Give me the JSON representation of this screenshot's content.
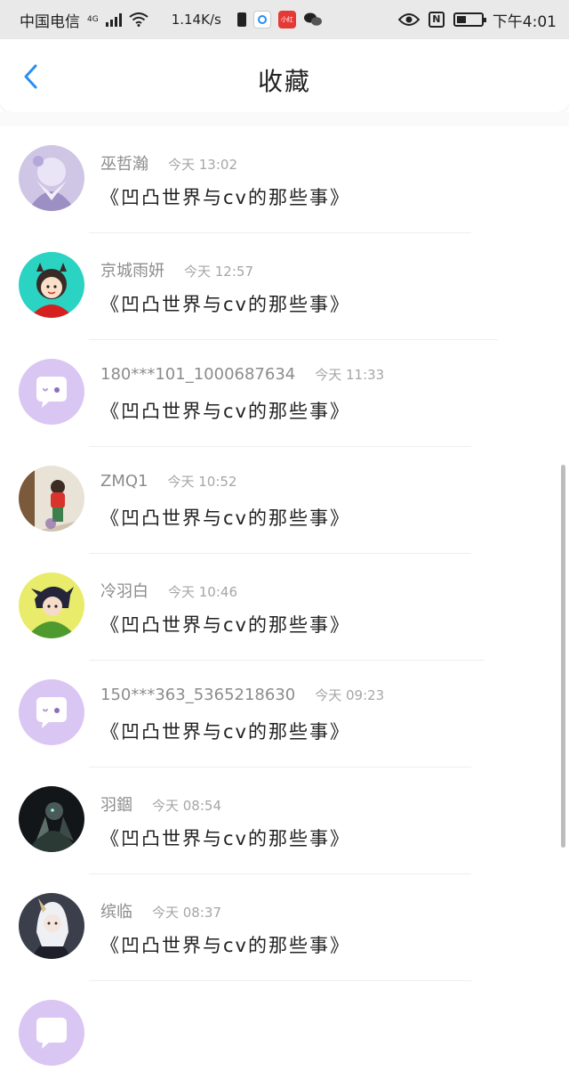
{
  "status_bar": {
    "carrier": "中国电信",
    "network": "4G",
    "speed": "1.14K/s",
    "app_badge": "小红书",
    "time": "下午4:01",
    "icons": [
      "signal-icon",
      "wifi-icon",
      "sim-alert-icon",
      "browser-icon",
      "xiaohongshu-icon",
      "wechat-icon",
      "eye-icon",
      "nfc-icon",
      "battery-icon"
    ]
  },
  "header": {
    "title": "收藏",
    "back_icon": "chevron-left-icon",
    "accent": "#2a8ef0"
  },
  "items": [
    {
      "user": "巫哲瀚",
      "time": "今天 13:02",
      "title": "《凹凸世界与cv的那些事》",
      "avatar": "anime-lavender"
    },
    {
      "user": "京城雨妍",
      "time": "今天 12:57",
      "title": "《凹凸世界与cv的那些事》",
      "avatar": "cartoon-girl-teal"
    },
    {
      "user": "180***101_1000687634",
      "time": "今天 11:33",
      "title": "《凹凸世界与cv的那些事》",
      "avatar": "default-chat"
    },
    {
      "user": "ZMQ1",
      "time": "今天 10:52",
      "title": "《凹凸世界与cv的那些事》",
      "avatar": "photo-child"
    },
    {
      "user": "冷羽白",
      "time": "今天 10:46",
      "title": "《凹凸世界与cv的那些事》",
      "avatar": "anime-boy-green"
    },
    {
      "user": "150***363_5365218630",
      "time": "今天 09:23",
      "title": "《凹凸世界与cv的那些事》",
      "avatar": "default-chat"
    },
    {
      "user": "羽錮",
      "time": "今天 08:54",
      "title": "《凹凸世界与cv的那些事》",
      "avatar": "dark-figure"
    },
    {
      "user": "缤临",
      "time": "今天 08:37",
      "title": "《凹凸世界与cv的那些事》",
      "avatar": "anime-white-hair"
    },
    {
      "user": "",
      "time": "",
      "title": "",
      "avatar": "default-chat"
    }
  ],
  "colors": {
    "default_avatar": "#d9c6f2",
    "title_text": "#222222",
    "meta_text": "#8c8c8c"
  }
}
